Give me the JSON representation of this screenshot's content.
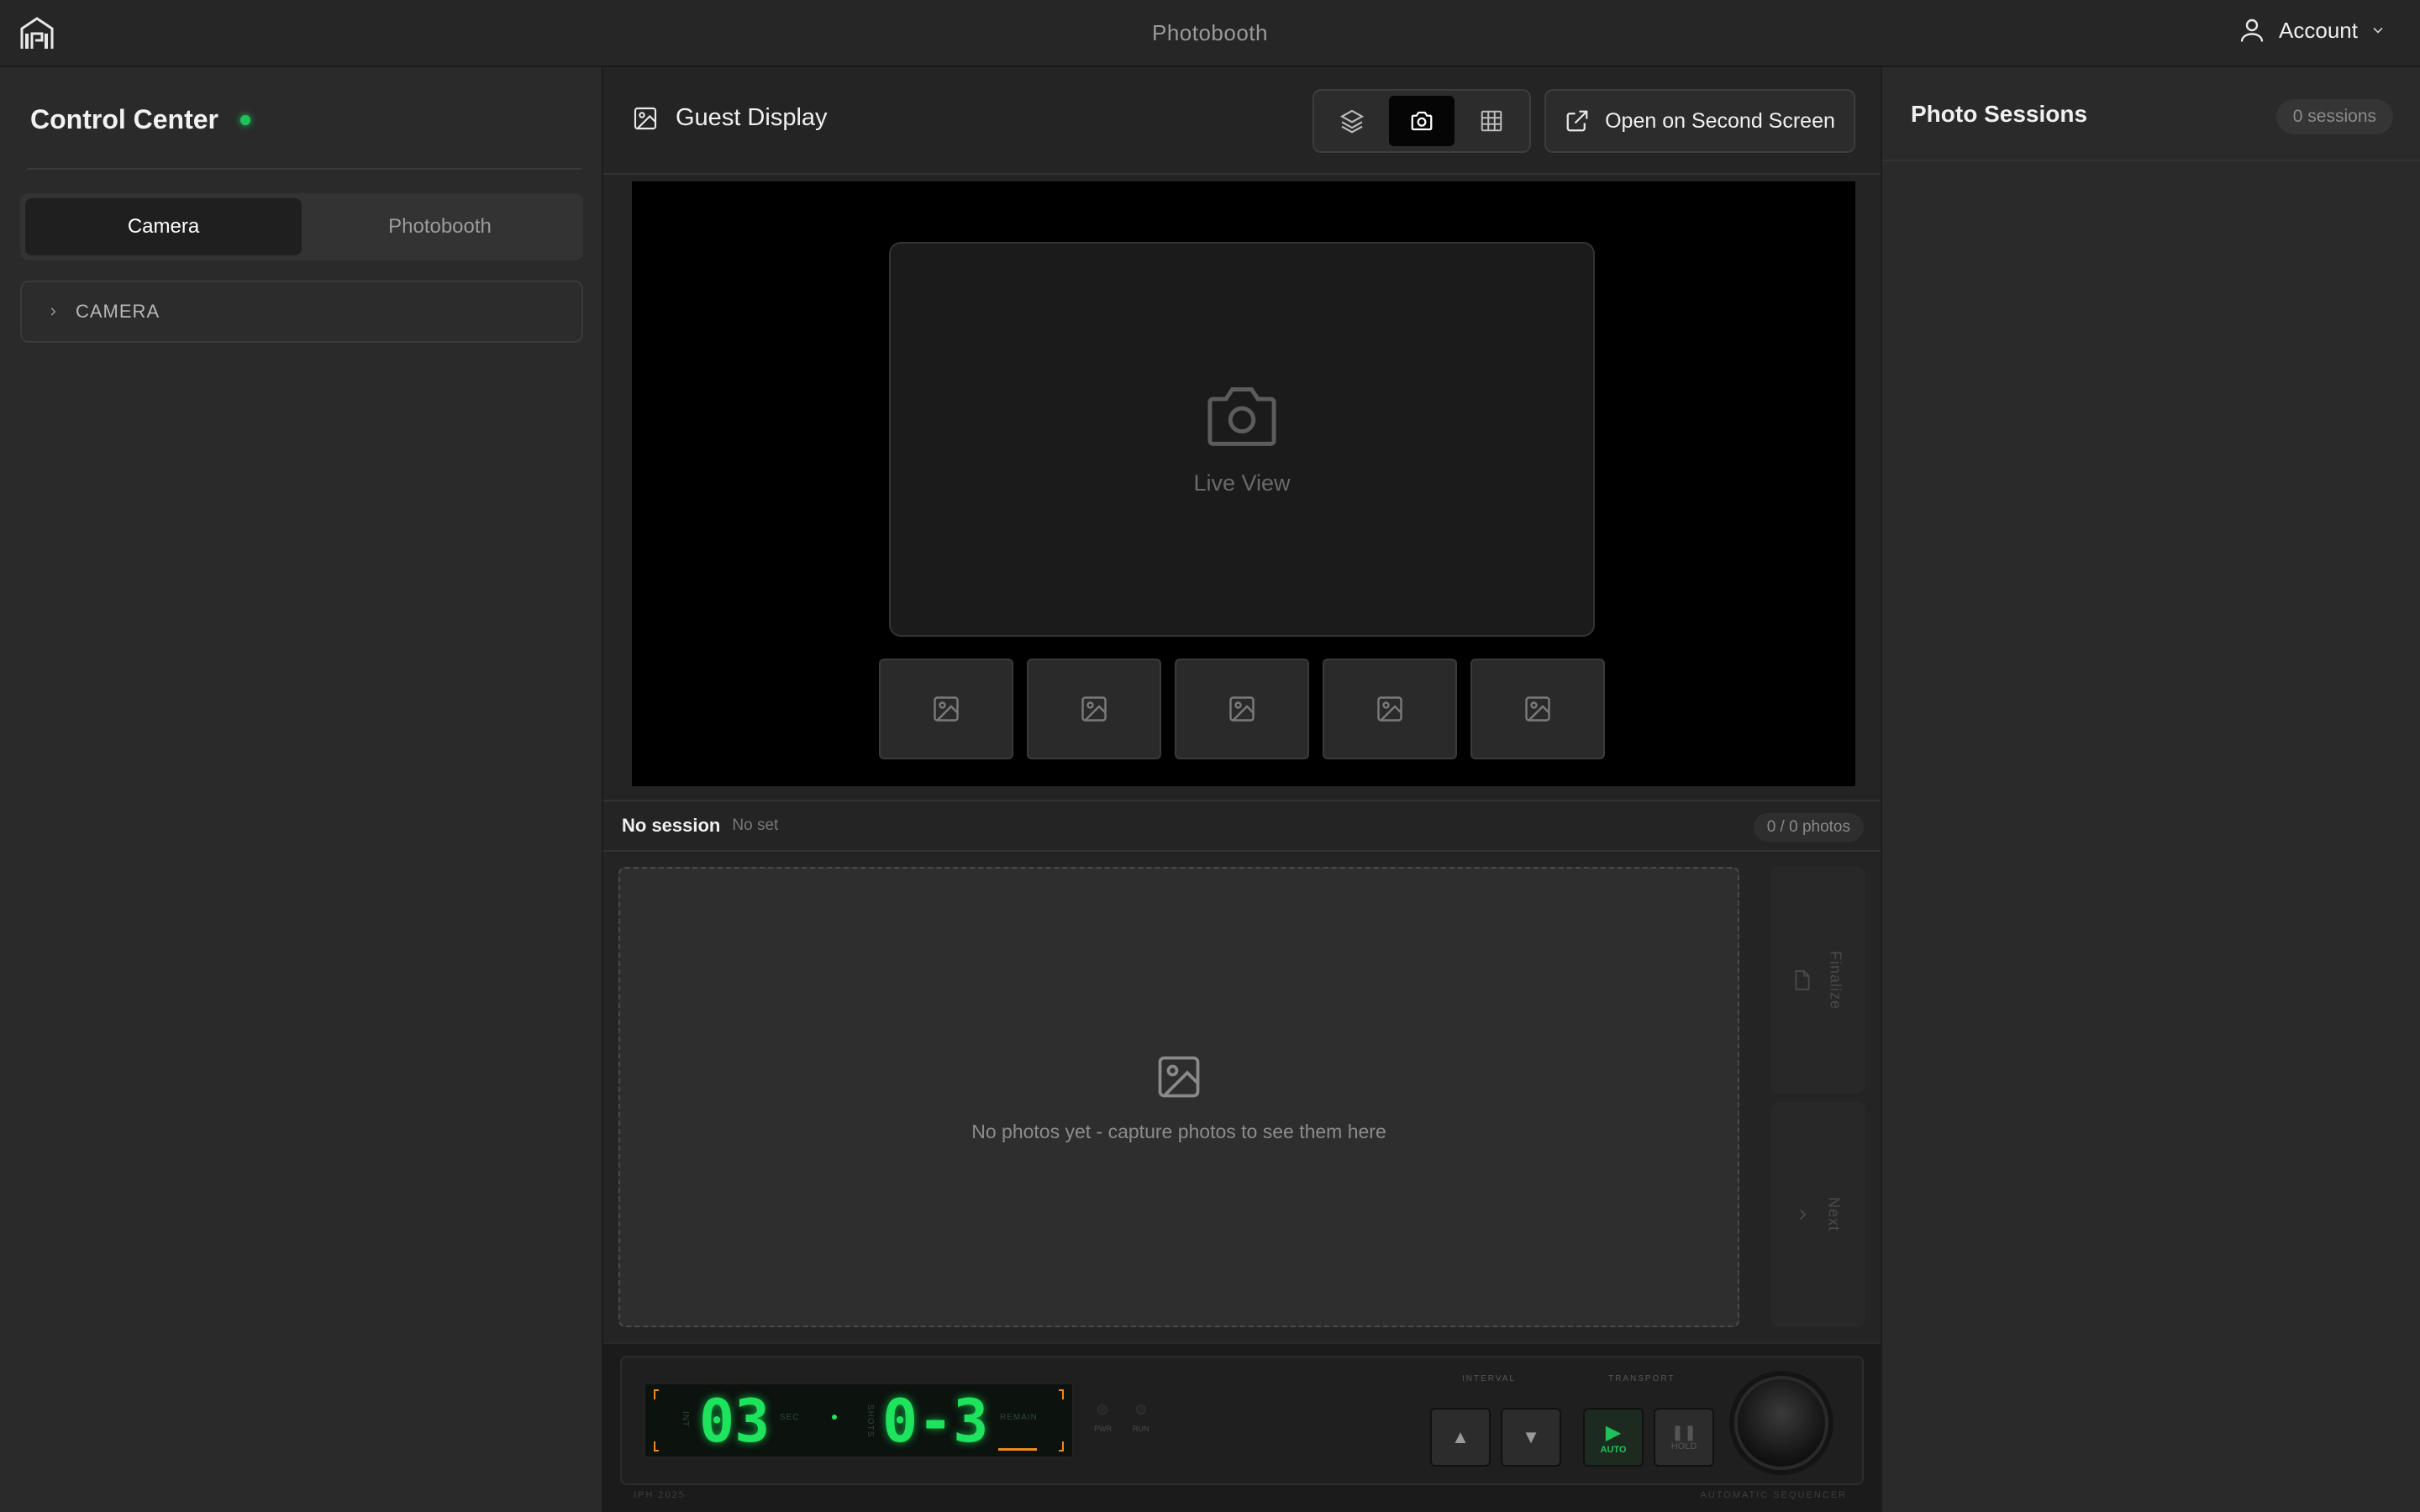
{
  "topbar": {
    "title": "Photobooth",
    "account_label": "Account"
  },
  "left": {
    "title": "Control Center",
    "tabs": [
      {
        "label": "Camera"
      },
      {
        "label": "Photobooth"
      }
    ],
    "accordion_label": "CAMERA"
  },
  "center": {
    "title": "Guest Display",
    "open_button": "Open on Second Screen",
    "live_view": "Live View",
    "session": {
      "name": "No session",
      "set": "No set",
      "count": "0 / 0 photos"
    },
    "empty_message": "No photos yet - capture photos to see them here",
    "finalize_label": "Finalize",
    "next_label": "Next"
  },
  "deck": {
    "interval_value": "03",
    "interval_unit": "SEC",
    "shots_value": "0-3",
    "shots_label": "REMAIN",
    "int_label": "INT",
    "shots_side_label": "SHOTS",
    "pwr": "PWR",
    "run": "RUN",
    "interval_label": "INTERVAL",
    "transport_label": "TRANSPORT",
    "auto": "AUTO",
    "hold": "HOLD",
    "footer_left": "IPH 2025",
    "footer_right": "AUTOMATIC SEQUENCER"
  },
  "right": {
    "title": "Photo Sessions",
    "badge": "0 sessions"
  },
  "colors": {
    "status_dot": "#1fc15a",
    "lcd_green": "#1ee35d",
    "accent_orange": "#f08a1a"
  }
}
